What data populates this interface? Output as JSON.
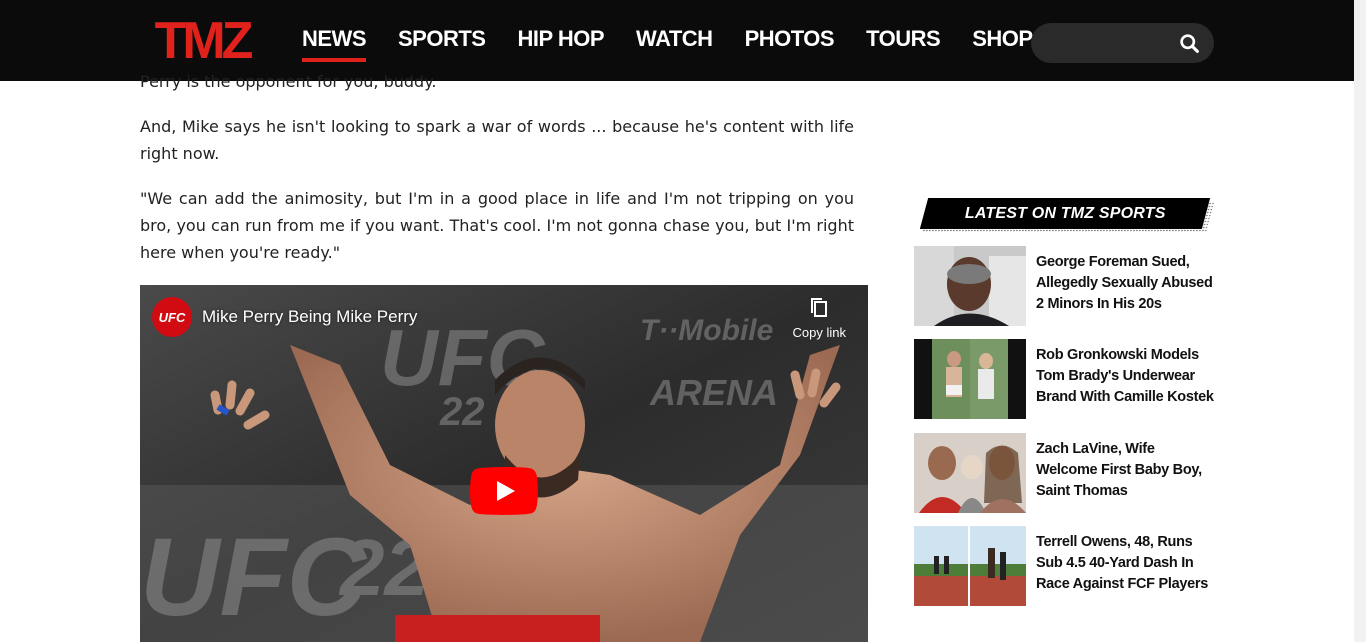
{
  "header": {
    "logo_text": "TMZ",
    "nav": [
      {
        "label": "NEWS",
        "active": true
      },
      {
        "label": "SPORTS",
        "active": false
      },
      {
        "label": "HIP HOP",
        "active": false
      },
      {
        "label": "WATCH",
        "active": false
      },
      {
        "label": "PHOTOS",
        "active": false
      },
      {
        "label": "TOURS",
        "active": false
      },
      {
        "label": "SHOP",
        "active": false
      }
    ],
    "search_placeholder": "",
    "accent_color": "#e1211b"
  },
  "article": {
    "paragraphs": [
      "Perry is the opponent for you, buddy.",
      "And, Mike says he isn't looking to spark a war of words ... because he's content with life right now.",
      "\"We can add the animosity, but I'm in a good place in life and I'm not tripping on you bro, you can run from me if you want. That's cool. I'm not gonna chase you, but I'm right here when you're ready.\""
    ]
  },
  "video": {
    "channel_logo": "UFC",
    "title": "Mike Perry Being Mike Perry",
    "copy_link_label": "Copy link",
    "play_color": "#ff0000"
  },
  "sidebar": {
    "title": "LATEST ON TMZ SPORTS",
    "stories": [
      {
        "title": "George Foreman Sued, Allegedly Sexually Abused 2 Minors In His 20s"
      },
      {
        "title": "Rob Gronkowski Models Tom Brady's Underwear Brand With Camille Kostek"
      },
      {
        "title": "Zach LaVine, Wife Welcome First Baby Boy, Saint Thomas"
      },
      {
        "title": "Terrell Owens, 48, Runs Sub 4.5 40-Yard Dash In Race Against FCF Players"
      }
    ]
  }
}
